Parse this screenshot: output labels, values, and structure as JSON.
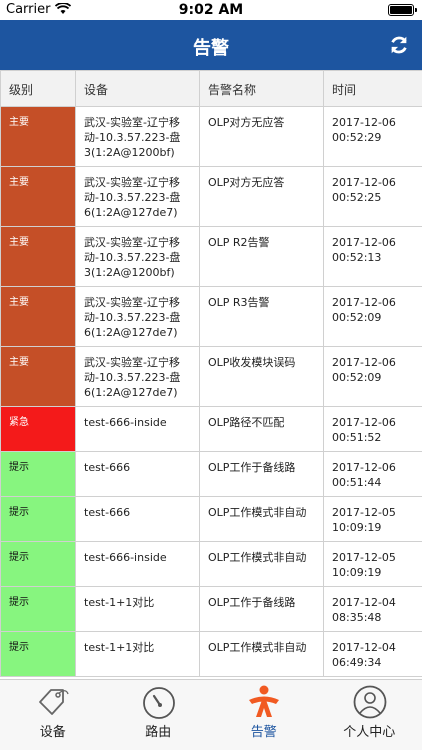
{
  "status_bar": {
    "carrier": "Carrier",
    "time": "9:02 AM"
  },
  "header": {
    "title": "告警"
  },
  "table": {
    "columns": [
      "级别",
      "设备",
      "告警名称",
      "时间"
    ],
    "rows": [
      {
        "level": "主要",
        "device": "武汉-实验室-辽宁移动-10.3.57.223-盘3(1:2A@1200bf)",
        "alarm": "OLP对方无应答",
        "time": "2017-12-06 00:52:29"
      },
      {
        "level": "主要",
        "device": "武汉-实验室-辽宁移动-10.3.57.223-盘6(1:2A@127de7)",
        "alarm": "OLP对方无应答",
        "time": "2017-12-06 00:52:25"
      },
      {
        "level": "主要",
        "device": "武汉-实验室-辽宁移动-10.3.57.223-盘3(1:2A@1200bf)",
        "alarm": "OLP R2告警",
        "time": "2017-12-06 00:52:13"
      },
      {
        "level": "主要",
        "device": "武汉-实验室-辽宁移动-10.3.57.223-盘6(1:2A@127de7)",
        "alarm": "OLP R3告警",
        "time": "2017-12-06 00:52:09"
      },
      {
        "level": "主要",
        "device": "武汉-实验室-辽宁移动-10.3.57.223-盘6(1:2A@127de7)",
        "alarm": "OLP收发模块误码",
        "time": "2017-12-06 00:52:09"
      },
      {
        "level": "紧急",
        "device": "test-666-inside",
        "alarm": "OLP路径不匹配",
        "time": "2017-12-06 00:51:52"
      },
      {
        "level": "提示",
        "device": "test-666",
        "alarm": "OLP工作于备线路",
        "time": "2017-12-06 00:51:44"
      },
      {
        "level": "提示",
        "device": "test-666",
        "alarm": "OLP工作模式非自动",
        "time": "2017-12-05 10:09:19"
      },
      {
        "level": "提示",
        "device": "test-666-inside",
        "alarm": "OLP工作模式非自动",
        "time": "2017-12-05 10:09:19"
      },
      {
        "level": "提示",
        "device": "test-1+1对比",
        "alarm": "OLP工作于备线路",
        "time": "2017-12-04 08:35:48"
      },
      {
        "level": "提示",
        "device": "test-1+1对比",
        "alarm": "OLP工作模式非自动",
        "time": "2017-12-04 06:49:34"
      }
    ]
  },
  "tabs": [
    {
      "label": "设备",
      "icon": "tag-icon"
    },
    {
      "label": "路由",
      "icon": "gauge-icon"
    },
    {
      "label": "告警",
      "icon": "alarm-person-icon"
    },
    {
      "label": "个人中心",
      "icon": "user-icon"
    }
  ],
  "colors": {
    "nav": "#1d55a0",
    "major": "#c54f27",
    "urgent": "#f41a1a",
    "hint": "#87f57f",
    "active_tab": "#1d55a0",
    "alarm_icon": "#f15a22"
  }
}
